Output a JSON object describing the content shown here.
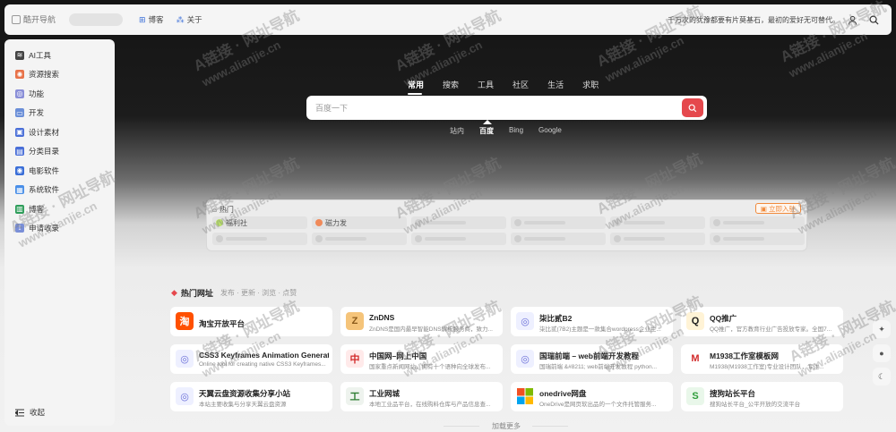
{
  "header": {
    "logo_text": "酷开导航",
    "nav": [
      {
        "label": "博客",
        "icon": "grid-icon"
      },
      {
        "label": "关于",
        "icon": "dots-icon"
      }
    ],
    "quote": "千万次的犹豫都要有片莫基石，最初的爱好无可替代。"
  },
  "sidebar": {
    "items": [
      {
        "label": "AI工具",
        "icon": "layers-icon",
        "color": "#444444"
      },
      {
        "label": "资源搜索",
        "icon": "search-globe-icon",
        "color": "#e8734a"
      },
      {
        "label": "功能",
        "icon": "function-icon",
        "color": "#8a8fd8"
      },
      {
        "label": "开发",
        "icon": "code-icon",
        "color": "#6b8fd8"
      },
      {
        "label": "设计素材",
        "icon": "palette-icon",
        "color": "#4a6fd8"
      },
      {
        "label": "分类目录",
        "icon": "folder-icon",
        "color": "#4a6fd8"
      },
      {
        "label": "电影软件",
        "icon": "film-icon",
        "color": "#3b6fd8"
      },
      {
        "label": "系统软件",
        "icon": "system-icon",
        "color": "#4a8fe8"
      },
      {
        "label": "博客",
        "icon": "blog-icon",
        "color": "#2e9d5a"
      },
      {
        "label": "申请收录",
        "icon": "link-icon",
        "color": "#7a8fd8"
      }
    ],
    "collapse_label": "收起"
  },
  "search": {
    "tabs": [
      "常用",
      "搜索",
      "工具",
      "社区",
      "生活",
      "求职"
    ],
    "active_tab": "常用",
    "placeholder": "百度一下",
    "engines": [
      "站内",
      "百度",
      "Bing",
      "Google"
    ],
    "active_engine": "百度"
  },
  "hot": {
    "title": "热门",
    "join_label": "立即入驻",
    "items": [
      {
        "label": "福利社",
        "icon_color": "#b9e06a"
      },
      {
        "label": "磁力发",
        "icon_color": "#f08a5a"
      }
    ]
  },
  "popular": {
    "title": "热门网址",
    "subtitle": "发布 · 更新 · 浏览 · 点赞",
    "load_more": "加载更多",
    "cards": [
      {
        "name": "淘宝开放平台",
        "desc": "",
        "icon": "淘",
        "icon_bg": "#ff5000",
        "icon_color": "#ffffff"
      },
      {
        "name": "ZnDNS",
        "desc": "ZnDNS是国内最早智能DNS解析服务商，致力...",
        "icon": "Z",
        "icon_bg": "#f5c47a",
        "icon_color": "#8a5a1a"
      },
      {
        "name": "柒比贰B2",
        "desc": "柒比贰(7B2)主题是一款集合wordpress企业主...",
        "icon": "◎",
        "icon_bg": "#eef0ff",
        "icon_color": "#6a6fd8"
      },
      {
        "name": "QQ推广",
        "desc": "QQ推广，官方教育行业广告投放专家。全国7...",
        "icon": "Q",
        "icon_bg": "#fff3d6",
        "icon_color": "#222222"
      },
      {
        "name": "CSS3 Keyframes Animation Generator",
        "desc": "Online tool for creating native CSS3 Keyframes...",
        "icon": "◎",
        "icon_bg": "#eef0ff",
        "icon_color": "#6a6fd8"
      },
      {
        "name": "中国网–网上中国",
        "desc": "国家重点新闻网站，拥有十个语种向全球发布...",
        "icon": "中",
        "icon_bg": "#ffeaea",
        "icon_color": "#d22b2b"
      },
      {
        "name": "国瑞前端 – web前端开发教程",
        "desc": "国瑞前端 &#8211; web前端开发教程 python...",
        "icon": "◎",
        "icon_bg": "#eef0ff",
        "icon_color": "#6a6fd8"
      },
      {
        "name": "M1938工作室模板网",
        "desc": "M1938(M1938工作室)专业设计团队，专注...",
        "icon": "M",
        "icon_bg": "#ffffff",
        "icon_color": "#d22b2b"
      },
      {
        "name": "天翼云盘资源收集分享小站",
        "desc": "本站主要收集与分享天翼云盘资源",
        "icon": "◎",
        "icon_bg": "#eef0ff",
        "icon_color": "#6a6fd8"
      },
      {
        "name": "工业网城",
        "desc": "本地工业品平台，在线购料仓库与产品信息查...",
        "icon": "工",
        "icon_bg": "#eef3ee",
        "icon_color": "#2e7d32"
      },
      {
        "name": "onedrive网盘",
        "desc": "OneDrive是网页软出品的一个文件托管服务...",
        "icon": "▦",
        "icon_bg": "#ffffff",
        "icon_color": "#ffffff"
      },
      {
        "name": "搜狗站长平台",
        "desc": "搜狗站长平台_公平开放的交流平台",
        "icon": "S",
        "icon_bg": "#e9f7ea",
        "icon_color": "#2e9d3a"
      }
    ]
  },
  "watermark": {
    "line1": "A链接 · 网址导航",
    "line2": "www.alianjie.cn"
  }
}
